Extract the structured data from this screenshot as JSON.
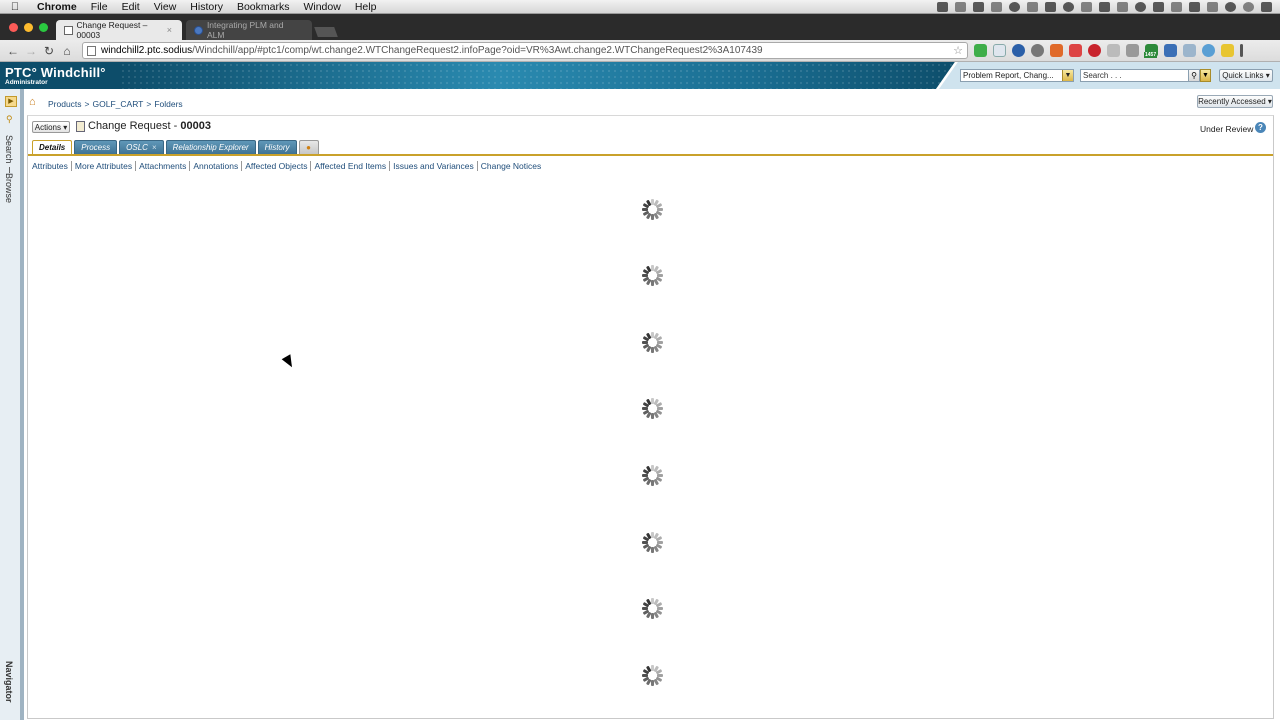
{
  "menu_bar": {
    "items": [
      "Chrome",
      "File",
      "Edit",
      "View",
      "History",
      "Bookmarks",
      "Window",
      "Help"
    ]
  },
  "browser": {
    "tabs": [
      {
        "title": "Change Request – 00003"
      },
      {
        "title": "Integrating PLM and ALM"
      }
    ],
    "url_host": "windchill2.ptc.sodius",
    "url_rest": "/Windchill/app/#ptc1/comp/wt.change2.WTChangeRequest2.infoPage?oid=VR%3Awt.change2.WTChangeRequest2%3A107439",
    "badge_count": "1457"
  },
  "header": {
    "product": "PTC° Windchill°",
    "role": "Administrator",
    "type_filter": "Problem Report, Chang...",
    "search_placeholder": "Search . . .",
    "quick_links": "Quick Links ▾"
  },
  "navigator": {
    "search": "Search",
    "browse": "Browse",
    "label": "Navigator"
  },
  "breadcrumb": {
    "items": [
      "Products",
      ">",
      "GOLF_CART",
      ">",
      "Folders"
    ],
    "recently_accessed": "Recently Accessed ▾"
  },
  "object": {
    "actions": "Actions ▾",
    "title_prefix": "Change Request - ",
    "number": "00003",
    "state": "Under Review"
  },
  "tabs": [
    "Details",
    "Process",
    "OSLC",
    "Relationship Explorer",
    "History"
  ],
  "subnav": [
    "Attributes",
    "More Attributes",
    "Attachments",
    "Annotations",
    "Affected Objects",
    "Affected End Items",
    "Issues and Variances",
    "Change Notices"
  ],
  "colors": {
    "header_blue": "#0d4d6a",
    "tab_blue": "#3f7394",
    "gold_accent": "#c9a12b",
    "link_blue": "#1f4d7a"
  }
}
